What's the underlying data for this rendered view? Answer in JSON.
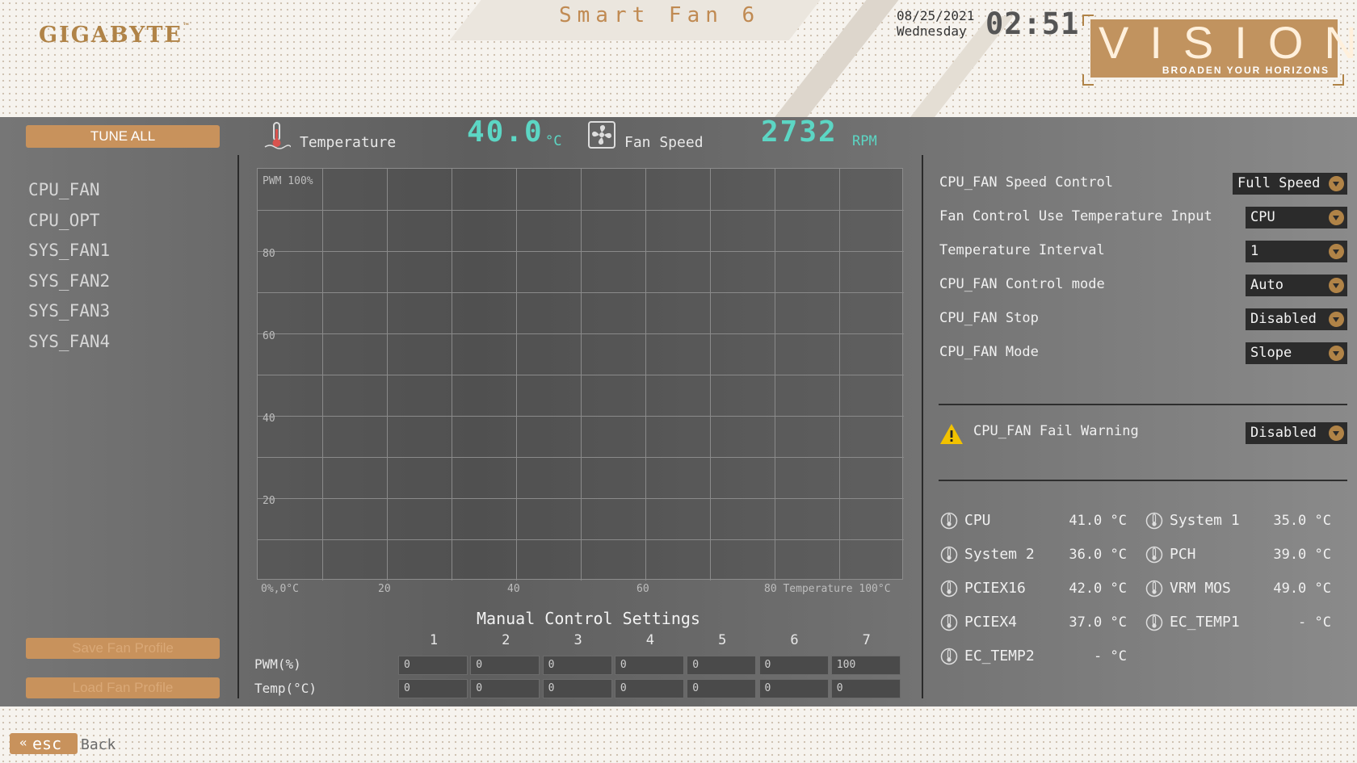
{
  "header": {
    "brand": "GIGABYTE",
    "brand_tm": "™",
    "title": "Smart Fan 6",
    "date": "08/25/2021",
    "weekday": "Wednesday",
    "time": "02:51",
    "vision_logo": "VISION",
    "vision_tagline": "BROADEN YOUR HORIZONS"
  },
  "sidebar": {
    "tune_all": "TUNE ALL",
    "fans": [
      "CPU_FAN",
      "CPU_OPT",
      "SYS_FAN1",
      "SYS_FAN2",
      "SYS_FAN3",
      "SYS_FAN4"
    ],
    "save_profile": "Save Fan Profile",
    "load_profile": "Load Fan Profile"
  },
  "readouts": {
    "temp_label": "Temperature",
    "temp_value": "40.0",
    "temp_unit": "°C",
    "fan_label": "Fan Speed",
    "fan_value": "2732",
    "fan_unit": "RPM"
  },
  "chart_data": {
    "type": "line",
    "ylabel": "PWM 100%",
    "xlabel": "Temperature 100°C",
    "origin_label": "0%,0°C",
    "y_ticks": [
      "80",
      "60",
      "40",
      "20"
    ],
    "x_ticks": [
      "20",
      "40",
      "60",
      "80"
    ],
    "xlim": [
      0,
      100
    ],
    "ylim": [
      0,
      100
    ],
    "grid": true,
    "series": []
  },
  "manual": {
    "title": "Manual Control Settings",
    "columns": [
      "1",
      "2",
      "3",
      "4",
      "5",
      "6",
      "7"
    ],
    "pwm_label": "PWM(%)",
    "temp_label": "Temp(°C)",
    "pwm_values": [
      "0",
      "0",
      "0",
      "0",
      "0",
      "0",
      "100"
    ],
    "temp_values": [
      "0",
      "0",
      "0",
      "0",
      "0",
      "0",
      "0"
    ]
  },
  "settings": {
    "speed_control_label": "CPU_FAN Speed Control",
    "speed_control_value": "Full Speed",
    "temp_input_label": "Fan Control Use Temperature Input",
    "temp_input_value": "CPU",
    "temp_interval_label": "Temperature Interval",
    "temp_interval_value": "1",
    "control_mode_label": "CPU_FAN Control mode",
    "control_mode_value": "Auto",
    "stop_label": "CPU_FAN Stop",
    "stop_value": "Disabled",
    "mode_label": "CPU_FAN Mode",
    "mode_value": "Slope",
    "fail_warning_label": "CPU_FAN Fail Warning",
    "fail_warning_value": "Disabled"
  },
  "sensors": {
    "cpu": {
      "name": "CPU",
      "value": "41.0 °C"
    },
    "system1": {
      "name": "System 1",
      "value": "35.0 °C"
    },
    "system2": {
      "name": "System 2",
      "value": "36.0 °C"
    },
    "pch": {
      "name": "PCH",
      "value": "39.0 °C"
    },
    "pciex16": {
      "name": "PCIEX16",
      "value": "42.0 °C"
    },
    "vrm": {
      "name": "VRM MOS",
      "value": "49.0 °C"
    },
    "pciex4": {
      "name": "PCIEX4",
      "value": "37.0 °C"
    },
    "ec_temp1": {
      "name": "EC_TEMP1",
      "value": "- °C"
    },
    "ec_temp2": {
      "name": "EC_TEMP2",
      "value": "- °C"
    }
  },
  "footer": {
    "esc": "esc",
    "back": "Back"
  },
  "colors": {
    "accent": "#c8925c",
    "value_teal": "#5cd6c4",
    "warning": "#f2c200"
  }
}
